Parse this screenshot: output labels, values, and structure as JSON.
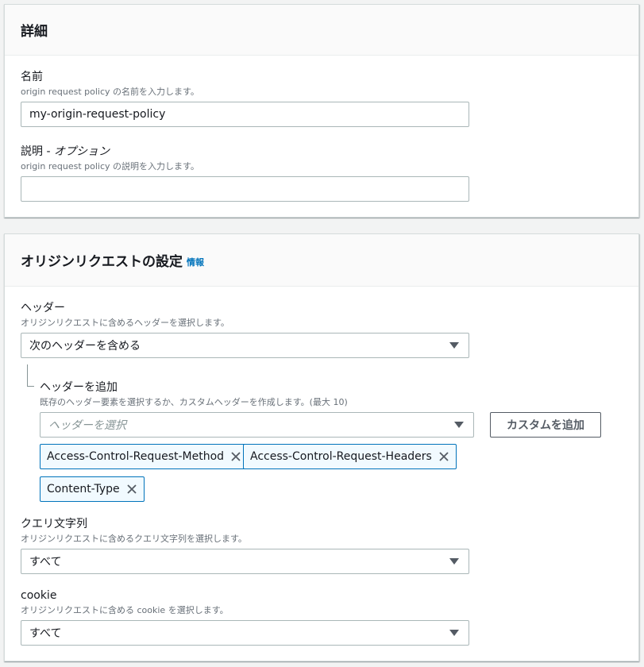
{
  "details": {
    "title": "詳細",
    "name_label": "名前",
    "name_desc": "origin request policy の名前を入力します。",
    "name_value": "my-origin-request-policy",
    "description_label": "説明 - ",
    "description_label_optional": "オプション",
    "description_desc": "origin request policy の説明を入力します。",
    "description_value": ""
  },
  "origin_settings": {
    "title": "オリジンリクエストの設定",
    "info": "情報",
    "headers_label": "ヘッダー",
    "headers_desc": "オリジンリクエストに含めるヘッダーを選択します。",
    "headers_selected": "次のヘッダーを含める",
    "add_header_label": "ヘッダーを追加",
    "add_header_desc": "既存のヘッダー要素を選択するか、カスタムヘッダーを作成します。(最大 10)",
    "header_select_placeholder": "ヘッダーを選択",
    "add_custom_button": "カスタムを追加",
    "tokens": [
      "Access-Control-Request-Method",
      "Access-Control-Request-Headers",
      "Content-Type"
    ],
    "query_label": "クエリ文字列",
    "query_desc": "オリジンリクエストに含めるクエリ文字列を選択します。",
    "query_selected": "すべて",
    "cookie_label": "cookie",
    "cookie_desc": "オリジンリクエストに含める cookie を選択します。",
    "cookie_selected": "すべて"
  },
  "colors": {
    "link": "#0073bb",
    "token_border": "#0073bb",
    "token_bg": "#f1faff"
  }
}
